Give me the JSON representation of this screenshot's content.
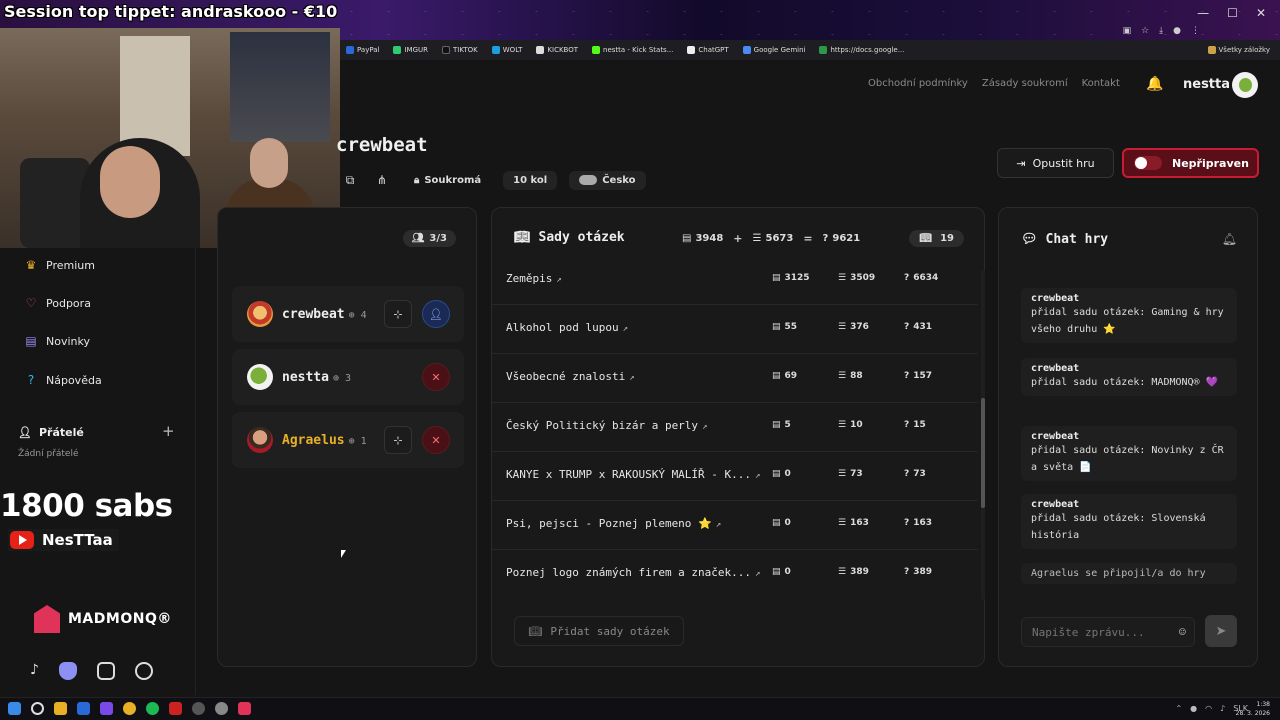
{
  "overlay": {
    "tipper": "Session top tippet: andraskooo - €10",
    "subs": "1800 sabs",
    "yt_channel": "NesTTaa",
    "brand": "MADMONQ®"
  },
  "bookmarks": [
    "PayPal",
    "IMGUR",
    "TIKTOK",
    "WOLT",
    "KICKBOT",
    "nestta - Kick Stats...",
    "ChatGPT",
    "Google Gemini",
    "https://docs.google..."
  ],
  "bookmarks_all": "Všetky záložky",
  "header": {
    "links": [
      "Obchodní podmínky",
      "Zásady soukromí",
      "Kontakt"
    ],
    "user": "nestta"
  },
  "game": {
    "title": "crewbeat",
    "privacy": "Soukromá",
    "rounds": "10 kol",
    "language": "Česko",
    "leave_label": "Opustit hru",
    "ready_label": "Nepřipraven"
  },
  "sidebar": {
    "items": [
      "Premium",
      "Podpora",
      "Novinky",
      "Nápověda"
    ],
    "friends_title": "Přátelé",
    "no_friends": "Žádní přátelé"
  },
  "players": {
    "count": "3/3",
    "list": [
      {
        "name": "crewbeat",
        "score": "4",
        "color": "#eeeeee"
      },
      {
        "name": "nestta",
        "score": "3",
        "color": "#eeeeee"
      },
      {
        "name": "Agraelus",
        "score": "1",
        "color": "#e8b025"
      }
    ]
  },
  "sets": {
    "title": "Sady otázek",
    "stat_a": "3948",
    "op_plus": "+",
    "stat_b": "5673",
    "op_eq": "=",
    "stat_total": "9621",
    "count": "19",
    "rows": [
      {
        "name": "Zeměpis",
        "a": "3125",
        "b": "3509",
        "c": "6634"
      },
      {
        "name": "Alkohol pod lupou",
        "a": "55",
        "b": "376",
        "c": "431"
      },
      {
        "name": "Všeobecné znalosti",
        "a": "69",
        "b": "88",
        "c": "157"
      },
      {
        "name": "Český Politický bizár a perly",
        "a": "5",
        "b": "10",
        "c": "15"
      },
      {
        "name": "KANYE x TRUMP x RAKOUSKÝ MALÍŘ - K...",
        "a": "0",
        "b": "73",
        "c": "73"
      },
      {
        "name": "Psi, pejsci - Poznej plemeno ⭐",
        "a": "0",
        "b": "163",
        "c": "163"
      },
      {
        "name": "Poznej logo známých firem a značek...",
        "a": "0",
        "b": "389",
        "c": "389"
      }
    ],
    "add_label": "Přidat sady otázek"
  },
  "chat": {
    "title": "Chat hry",
    "messages": [
      {
        "author": "crewbeat",
        "text": "přidal sadu otázek: Gaming & hry všeho druhu ⭐"
      },
      {
        "author": "crewbeat",
        "text": "přidal sadu otázek: MADMONQ® 💜"
      },
      {
        "author": "crewbeat",
        "text": "přidal sadu otázek: Novinky z ČR a světa 📄"
      },
      {
        "author": "crewbeat",
        "text": "přidal sadu otázek: Slovenská história"
      }
    ],
    "system": "Agraelus se připojil/a do hry",
    "placeholder": "Napište zprávu..."
  },
  "taskbar": {
    "lang": "SLK",
    "time": "1:38",
    "date": "28. 3. 2026"
  }
}
